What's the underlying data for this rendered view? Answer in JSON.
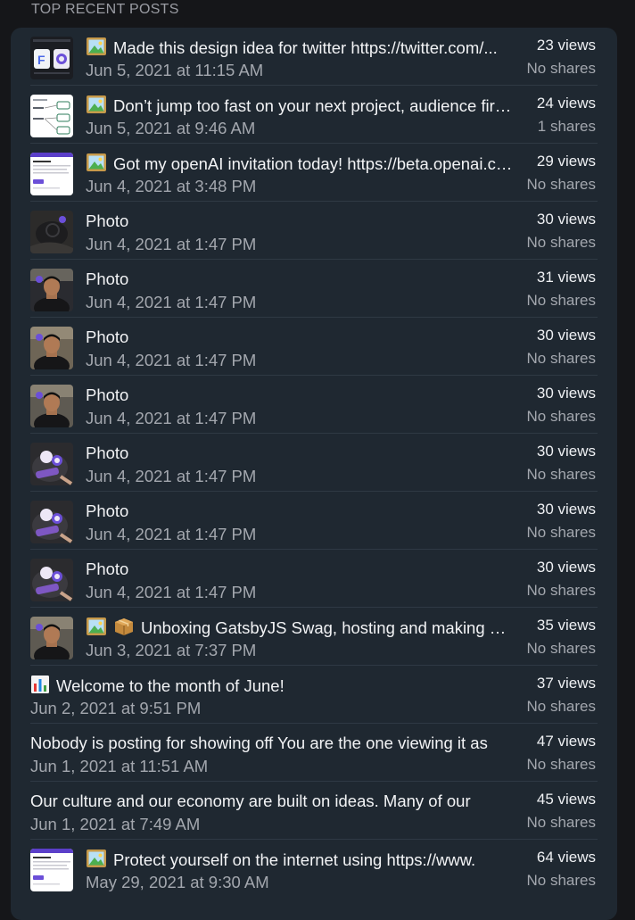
{
  "section_title": "TOP RECENT POSTS",
  "posts": [
    {
      "thumb": "design-screenshot-thumbnail",
      "emoji": "framed-picture-icon",
      "title": "Made this design idea for twitter  https://twitter.com/...",
      "date": "Jun 5, 2021 at 11:15 AM",
      "views": "23 views",
      "shares": "No shares"
    },
    {
      "thumb": "diagram-screenshot-thumbnail",
      "emoji": "framed-picture-icon",
      "title": "Don’t jump too fast on your  next project, audience first...",
      "date": "Jun 5, 2021 at 9:46 AM",
      "views": "24 views",
      "shares": "1 shares"
    },
    {
      "thumb": "web-page-screenshot-thumbnail",
      "emoji": "framed-picture-icon",
      "title": "Got my openAI invitation today! https://beta.openai.com",
      "date": "Jun 4, 2021 at 3:48 PM",
      "views": "29 views",
      "shares": "No shares"
    },
    {
      "thumb": "dark-fabric-photo-thumbnail",
      "emoji": "",
      "title": "Photo",
      "date": "Jun 4, 2021 at 1:47 PM",
      "views": "30 views",
      "shares": "No shares"
    },
    {
      "thumb": "person-photo-thumbnail",
      "emoji": "",
      "title": "Photo",
      "date": "Jun 4, 2021 at 1:47 PM",
      "views": "31 views",
      "shares": "No shares"
    },
    {
      "thumb": "person-photo-thumbnail",
      "emoji": "",
      "title": "Photo",
      "date": "Jun 4, 2021 at 1:47 PM",
      "views": "30 views",
      "shares": "No shares"
    },
    {
      "thumb": "person-photo-thumbnail",
      "emoji": "",
      "title": "Photo",
      "date": "Jun 4, 2021 at 1:47 PM",
      "views": "30 views",
      "shares": "No shares"
    },
    {
      "thumb": "sticker-photo-thumbnail",
      "emoji": "",
      "title": "Photo",
      "date": "Jun 4, 2021 at 1:47 PM",
      "views": "30 views",
      "shares": "No shares"
    },
    {
      "thumb": "sticker-photo-thumbnail",
      "emoji": "",
      "title": "Photo",
      "date": "Jun 4, 2021 at 1:47 PM",
      "views": "30 views",
      "shares": "No shares"
    },
    {
      "thumb": "sticker-photo-thumbnail",
      "emoji": "",
      "title": "Photo",
      "date": "Jun 4, 2021 at 1:47 PM",
      "views": "30 views",
      "shares": "No shares"
    },
    {
      "thumb": "person-photo-thumbnail",
      "emoji": "framed-picture-and-package-icons",
      "title": "Unboxing GatsbyJS Swag, hosting and making a website",
      "date": "Jun 3, 2021 at 7:37 PM",
      "views": "35 views",
      "shares": "No shares"
    },
    {
      "thumb": "",
      "emoji": "bar-chart-icon",
      "title": "Welcome to the month of June!",
      "date": "Jun 2, 2021 at 9:51 PM",
      "views": "37 views",
      "shares": "No shares"
    },
    {
      "thumb": "",
      "emoji": "",
      "title": "Nobody is posting for showing off You are the one viewing it as",
      "date": "Jun 1, 2021 at 11:51 AM",
      "views": "47 views",
      "shares": "No shares"
    },
    {
      "thumb": "",
      "emoji": "",
      "title": "Our culture and our economy are built on ideas. Many of our",
      "date": "Jun 1, 2021 at 7:49 AM",
      "views": "45 views",
      "shares": "No shares"
    },
    {
      "thumb": "web-page-screenshot-thumbnail",
      "emoji": "framed-picture-icon",
      "title": "Protect yourself on the internet using https://www.",
      "date": "May 29, 2021 at 9:30 AM",
      "views": "64 views",
      "shares": "No shares"
    }
  ],
  "colors": {
    "page_bg": "#151619",
    "card_bg": "#1f2831",
    "divider": "#2f3944",
    "title_text": "#f2f3f5",
    "secondary_text": "#a3a7ae",
    "section_title": "#9a9ca3",
    "accent_purple": "#6b4fd8"
  }
}
